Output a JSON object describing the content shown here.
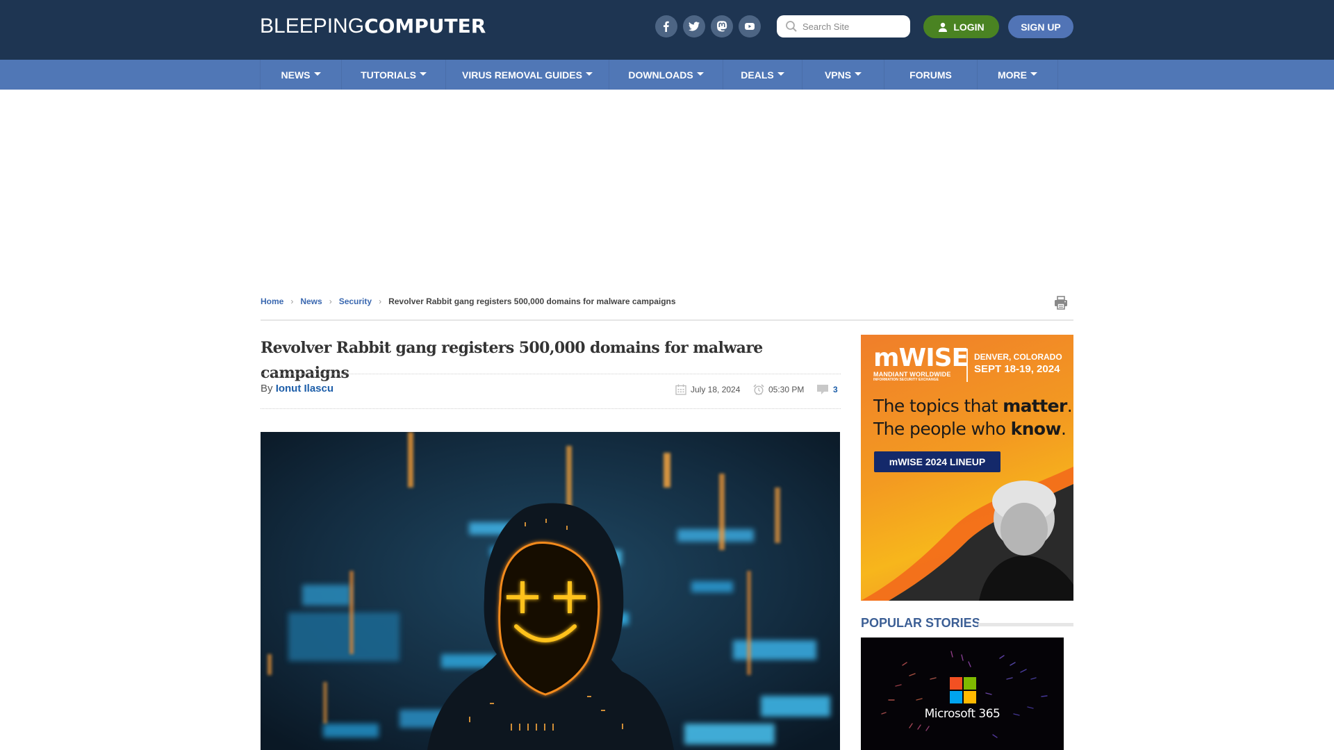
{
  "site": {
    "logo_light": "BLEEPING",
    "logo_bold": "COMPUTER"
  },
  "header": {
    "socials": [
      {
        "name": "facebook",
        "icon": "facebook-icon"
      },
      {
        "name": "twitter",
        "icon": "twitter-icon"
      },
      {
        "name": "mastodon",
        "icon": "mastodon-icon"
      },
      {
        "name": "youtube",
        "icon": "youtube-icon"
      }
    ],
    "search_placeholder": "Search Site",
    "search_value": "",
    "login_label": "LOGIN",
    "signup_label": "SIGN UP"
  },
  "nav": {
    "items": [
      {
        "label": "NEWS",
        "dropdown": true
      },
      {
        "label": "TUTORIALS",
        "dropdown": true
      },
      {
        "label": "VIRUS REMOVAL GUIDES",
        "dropdown": true
      },
      {
        "label": "DOWNLOADS",
        "dropdown": true
      },
      {
        "label": "DEALS",
        "dropdown": true
      },
      {
        "label": "VPNS",
        "dropdown": true
      },
      {
        "label": "FORUMS",
        "dropdown": false
      },
      {
        "label": "MORE",
        "dropdown": true
      }
    ]
  },
  "breadcrumb": {
    "items": [
      "Home",
      "News",
      "Security"
    ],
    "current": "Revolver Rabbit gang registers 500,000 domains for malware campaigns",
    "separator": "›"
  },
  "article": {
    "title": "Revolver Rabbit gang registers 500,000 domains for malware campaigns",
    "by_label": "By",
    "author": "Ionut Ilascu",
    "date": "July 18, 2024",
    "time": "05:30 PM",
    "comments": "3"
  },
  "ad": {
    "brand": "mWISE",
    "brand_sub1": "MANDIANT WORLDWIDE",
    "brand_sub2": "INFORMATION SECURITY EXCHANGE",
    "location": "DENVER, COLORADO",
    "dates": "SEPT 18-19, 2024",
    "headline_1a": "The topics that ",
    "headline_1b": "matter",
    "headline_1c": ".",
    "headline_2a": "The people who ",
    "headline_2b": "know",
    "headline_2c": ".",
    "cta": "mWISE 2024 LINEUP"
  },
  "sidebar": {
    "popular_heading": "POPULAR STORIES",
    "stories": [
      {
        "image_caption": "Microsoft 365"
      }
    ]
  },
  "colors": {
    "header_bg": "#1e3552",
    "nav_bg": "#5077b6",
    "login_green": "#4a8322",
    "signup_blue": "#5174b6",
    "link_blue": "#1d5ea9"
  }
}
